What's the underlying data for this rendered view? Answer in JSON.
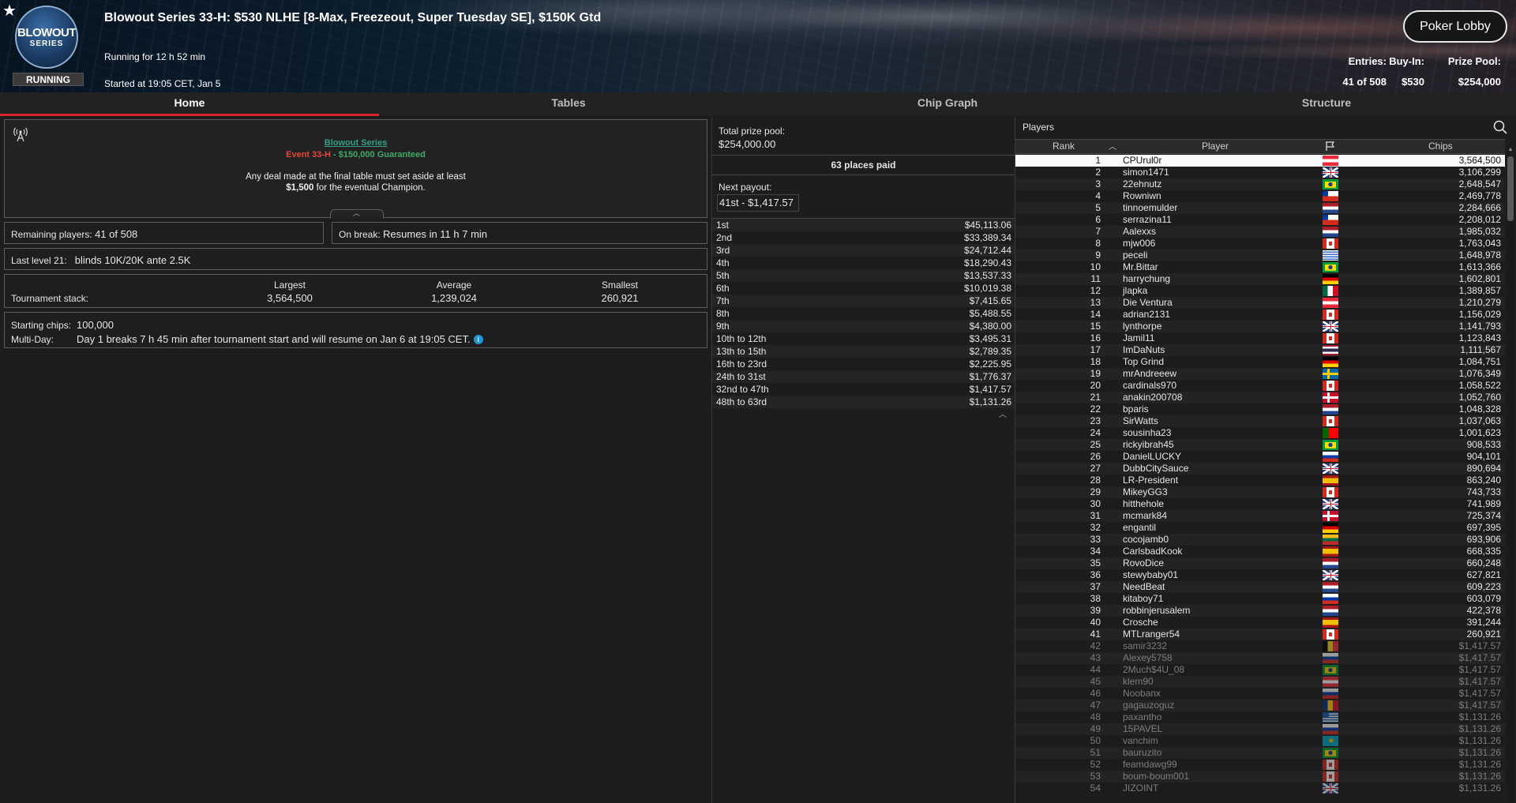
{
  "header": {
    "title": "Blowout Series 33-H: $530 NLHE [8-Max, Freezeout, Super Tuesday SE], $150K Gtd",
    "running_for": "Running for 12 h 52 min",
    "started_at": "Started at 19:05 CET, Jan 5",
    "status": "RUNNING",
    "logo_line1": "BLOWOUT",
    "logo_line2": "SERIES",
    "lobby_button": "Poker Lobby",
    "stats": {
      "entries_label": "Entries:",
      "entries_value": "41 of 508",
      "buyin_label": "Buy-In:",
      "buyin_value": "$530",
      "prizepool_label": "Prize Pool:",
      "prizepool_value": "$254,000"
    }
  },
  "tabs": [
    {
      "label": "Home",
      "active": true
    },
    {
      "label": "Tables",
      "active": false
    },
    {
      "label": "Chip Graph",
      "active": false
    },
    {
      "label": "Structure",
      "active": false
    }
  ],
  "home": {
    "series_link": "Blowout Series",
    "event_name": "Event 33-H",
    "event_sep": " - ",
    "event_gtd": "$150,000 Guaranteed",
    "deal_line1": "Any deal made at the final table must set aside at least",
    "deal_amount": "$1,500",
    "deal_line2_rest": " for the eventual Champion.",
    "remaining_label": "Remaining players:",
    "remaining_value": "41 of 508",
    "break_label": "On break:",
    "break_value": "Resumes in 11 h 7 min",
    "level_label": "Last level 21:",
    "level_value": "blinds 10K/20K ante 2.5K",
    "stack_label": "Tournament stack:",
    "largest_label": "Largest",
    "largest_value": "3,564,500",
    "average_label": "Average",
    "average_value": "1,239,024",
    "smallest_label": "Smallest",
    "smallest_value": "260,921",
    "starting_label": "Starting chips:",
    "starting_value": "100,000",
    "multiday_label": "Multi-Day:",
    "multiday_value": "Day 1 breaks 7 h 45 min after tournament start and will resume on Jan 6 at 19:05 CET."
  },
  "prizes": {
    "pool_label": "Total prize pool:",
    "pool_value": "$254,000.00",
    "places_paid": "63 places paid",
    "next_label": "Next payout:",
    "next_value": "41st - $1,417.57",
    "payouts": [
      [
        "1st",
        "$45,113.06"
      ],
      [
        "2nd",
        "$33,389.34"
      ],
      [
        "3rd",
        "$24,712.44"
      ],
      [
        "4th",
        "$18,290.43"
      ],
      [
        "5th",
        "$13,537.33"
      ],
      [
        "6th",
        "$10,019.38"
      ],
      [
        "7th",
        "$7,415.65"
      ],
      [
        "8th",
        "$5,488.55"
      ],
      [
        "9th",
        "$4,380.00"
      ],
      [
        "10th to 12th",
        "$3,495.31"
      ],
      [
        "13th to 15th",
        "$2,789.35"
      ],
      [
        "16th to 23rd",
        "$2,225.95"
      ],
      [
        "24th to 31st",
        "$1,776.37"
      ],
      [
        "32nd to 47th",
        "$1,417.57"
      ],
      [
        "48th to 63rd",
        "$1,131.26"
      ]
    ]
  },
  "players": {
    "title": "Players",
    "col_rank": "Rank",
    "col_player": "Player",
    "col_chips": "Chips",
    "rows": [
      [
        "1",
        "CPUrul0r",
        "at",
        "3,564,500"
      ],
      [
        "2",
        "simon1471",
        "gb",
        "3,106,299"
      ],
      [
        "3",
        "22ehnutz",
        "br",
        "2,648,547"
      ],
      [
        "4",
        "Rowniwn",
        "cl",
        "2,469,778"
      ],
      [
        "5",
        "tinnoemulder",
        "nl",
        "2,284,666"
      ],
      [
        "6",
        "serrazina11",
        "cl",
        "2,208,012"
      ],
      [
        "7",
        "Aalexxs",
        "nl",
        "1,985,032"
      ],
      [
        "8",
        "mjw006",
        "ca",
        "1,763,043"
      ],
      [
        "9",
        "peceli",
        "uy",
        "1,648,978"
      ],
      [
        "10",
        "Mr.Bittar",
        "br",
        "1,613,366"
      ],
      [
        "11",
        "harrychung",
        "de",
        "1,602,801"
      ],
      [
        "12",
        "jlapka",
        "mx",
        "1,389,857"
      ],
      [
        "13",
        "Die Ventura",
        "at",
        "1,210,279"
      ],
      [
        "14",
        "adrian2131",
        "ca",
        "1,156,029"
      ],
      [
        "15",
        "lynthorpe",
        "gb",
        "1,141,793"
      ],
      [
        "16",
        "Jamil11",
        "ca",
        "1,123,843"
      ],
      [
        "17",
        "ImDaNuts",
        "th",
        "1,111,567"
      ],
      [
        "18",
        "Top Grind",
        "de",
        "1,084,751"
      ],
      [
        "19",
        "mrAndreeew",
        "se",
        "1,076,349"
      ],
      [
        "20",
        "cardinals970",
        "ca",
        "1,058,522"
      ],
      [
        "21",
        "anakin200708",
        "dk",
        "1,052,760"
      ],
      [
        "22",
        "bparis",
        "nl",
        "1,048,328"
      ],
      [
        "23",
        "SirWatts",
        "ca",
        "1,037,063"
      ],
      [
        "24",
        "sousinha23",
        "pt",
        "1,001,623"
      ],
      [
        "25",
        "rickyibrah45",
        "br",
        "908,533"
      ],
      [
        "26",
        "DanielLUCKY",
        "ru",
        "904,101"
      ],
      [
        "27",
        "DubbCitySauce",
        "gb",
        "890,694"
      ],
      [
        "28",
        "LR-President",
        "es",
        "863,240"
      ],
      [
        "29",
        "MikeyGG3",
        "ca",
        "743,733"
      ],
      [
        "30",
        "hitthehole",
        "gb",
        "741,989"
      ],
      [
        "31",
        "mcmark84",
        "dk",
        "725,374"
      ],
      [
        "32",
        "engantil",
        "de",
        "697,395"
      ],
      [
        "33",
        "cocojamb0",
        "lt",
        "693,906"
      ],
      [
        "34",
        "CarlsbadKook",
        "es",
        "668,335"
      ],
      [
        "35",
        "RovoDice",
        "nl",
        "660,248"
      ],
      [
        "36",
        "stewybaby01",
        "gb",
        "627,821"
      ],
      [
        "37",
        "NeedBeat",
        "nl",
        "609,223"
      ],
      [
        "38",
        "kitaboy71",
        "ru",
        "603,079"
      ],
      [
        "39",
        "robbinjerusalem",
        "nl",
        "422,378"
      ],
      [
        "40",
        "Crosche",
        "es",
        "391,244"
      ],
      [
        "41",
        "MTLranger54",
        "ca",
        "260,921"
      ],
      [
        "42",
        "samir3232",
        "be",
        "$1,417.57"
      ],
      [
        "43",
        "Alexey5758",
        "ru",
        "$1,417.57"
      ],
      [
        "44",
        "2Much$4U_08",
        "br",
        "$1,417.57"
      ],
      [
        "45",
        "klem90",
        "at",
        "$1,417.57"
      ],
      [
        "46",
        "Noobanx",
        "ru",
        "$1,417.57"
      ],
      [
        "47",
        "gagauzoguz",
        "ro",
        "$1,417.57"
      ],
      [
        "48",
        "paxantho",
        "gr",
        "$1,131.26"
      ],
      [
        "49",
        "15PAVEL",
        "ru",
        "$1,131.26"
      ],
      [
        "50",
        "vanchim",
        "kz",
        "$1,131.26"
      ],
      [
        "51",
        "bauruzito",
        "br",
        "$1,131.26"
      ],
      [
        "52",
        "feamdawg99",
        "ca",
        "$1,131.26"
      ],
      [
        "53",
        "boum-boum001",
        "ca",
        "$1,131.26"
      ],
      [
        "54",
        "JIZOINT",
        "gb",
        "$1,131.26"
      ]
    ],
    "busted_from_rank": 42
  }
}
